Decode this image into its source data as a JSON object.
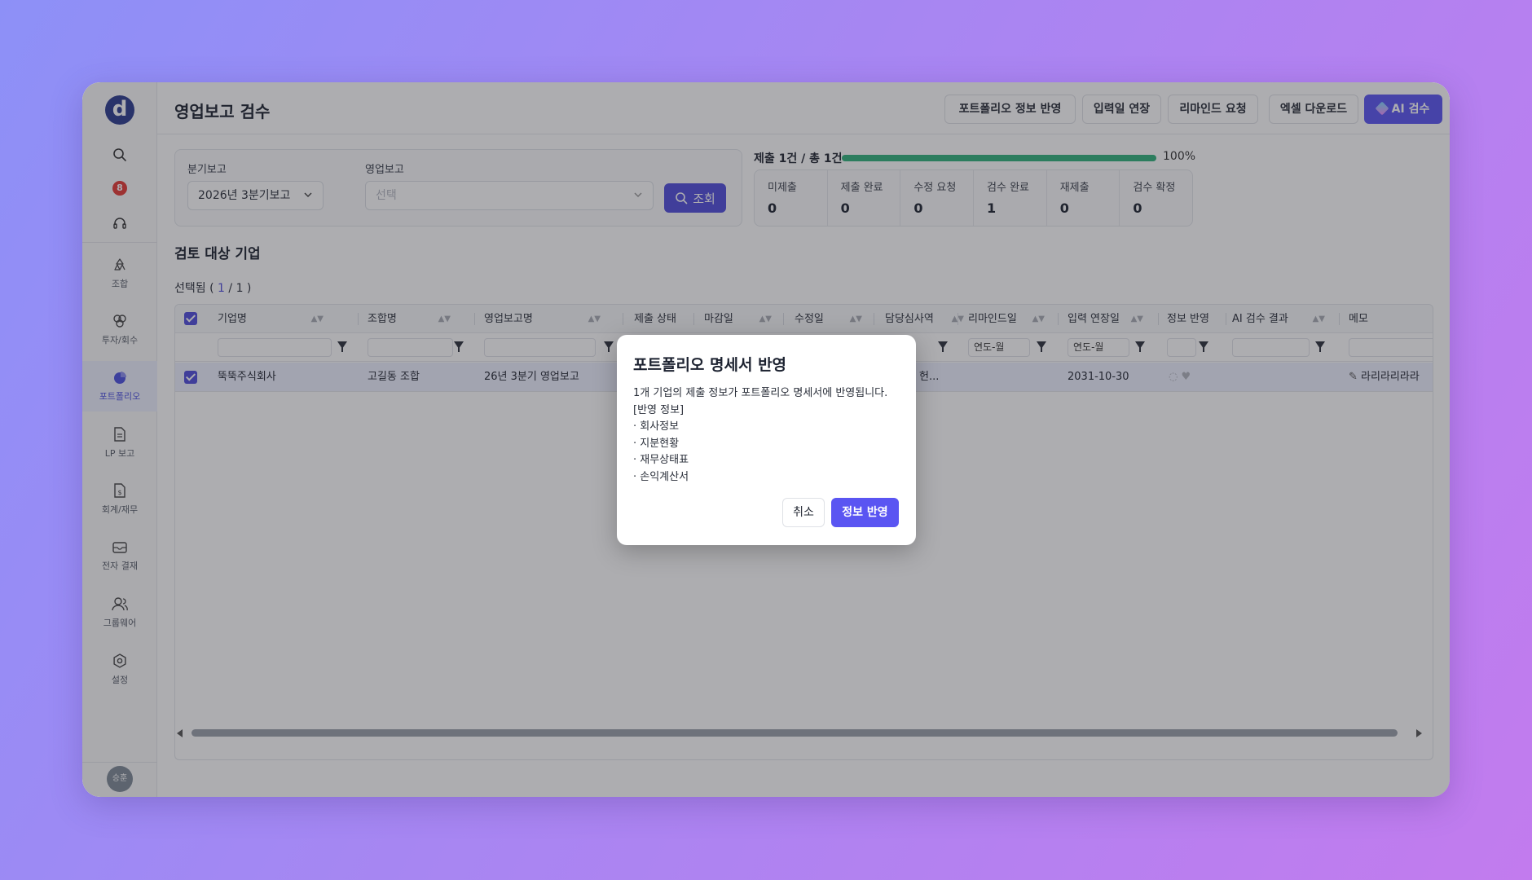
{
  "sidebar": {
    "logo": "d",
    "badge": "8",
    "items": [
      {
        "label": "조합",
        "icon": "recycle-icon"
      },
      {
        "label": "투자/회수",
        "icon": "investment-icon"
      },
      {
        "label": "포트폴리오",
        "icon": "pie-chart-icon"
      },
      {
        "label": "LP 보고",
        "icon": "document-icon"
      },
      {
        "label": "회계/재무",
        "icon": "finance-document-icon"
      },
      {
        "label": "전자 결재",
        "icon": "mail-icon"
      },
      {
        "label": "그룹웨어",
        "icon": "users-icon"
      },
      {
        "label": "설정",
        "icon": "gear-icon"
      }
    ],
    "avatar": "승훈"
  },
  "header": {
    "title": "영업보고 검수",
    "buttons": {
      "portfolio_reflect": "포트폴리오 정보 반영",
      "extend_input": "입력일 연장",
      "remind": "리마인드 요청",
      "excel": "엑셀 다운로드",
      "ai_review": "AI 검수"
    }
  },
  "filters": {
    "quarter_label": "분기보고",
    "quarter_value": "2026년 3분기보고",
    "report_label": "영업보고",
    "report_placeholder": "선택",
    "search_label": "조회"
  },
  "progress": {
    "label": "제출 1건 / 총 1건",
    "percent_text": "100%",
    "percent": 100
  },
  "stats": [
    {
      "label": "미제출",
      "value": "0"
    },
    {
      "label": "제출 완료",
      "value": "0"
    },
    {
      "label": "수정 요청",
      "value": "0"
    },
    {
      "label": "검수 완료",
      "value": "1"
    },
    {
      "label": "재제출",
      "value": "0"
    },
    {
      "label": "검수 확정",
      "value": "0"
    }
  ],
  "section": {
    "title": "검토 대상 기업",
    "selected_prefix": "선택됨 ( ",
    "selected_count": "1",
    "selected_sep": " / ",
    "selected_total": "1",
    "selected_suffix": " )"
  },
  "table": {
    "columns": {
      "company": "기업명",
      "union": "조합명",
      "report": "영업보고명",
      "status": "제출 상태",
      "deadline": "마감일",
      "modified": "수정일",
      "reviewer": "담당심사역",
      "remind": "리마인드일",
      "extension": "입력 연장일",
      "reflect": "정보 반영",
      "ai": "AI 검수 결과",
      "memo": "메모"
    },
    "filter_date_placeholder": "연도-월",
    "row": {
      "company": "뚝뚝주식회사",
      "union": "고길동 조합",
      "report": "26년 3분기 영업보고",
      "reviewer": "헌...",
      "extension": "2031-10-30",
      "memo": "라리라리라라"
    }
  },
  "modal": {
    "title": "포트폴리오 명세서 반영",
    "body": [
      "1개 기업의 제출 정보가 포트폴리오 명세서에 반영됩니다.",
      "[반영 정보]",
      "· 회사정보",
      "· 지분현황",
      "· 재무상태표",
      "· 손익계산서"
    ],
    "cancel": "취소",
    "confirm": "정보 반영"
  },
  "colors": {
    "accent": "#5a55f2",
    "progress": "#2fb27b",
    "badge": "#e53935"
  }
}
